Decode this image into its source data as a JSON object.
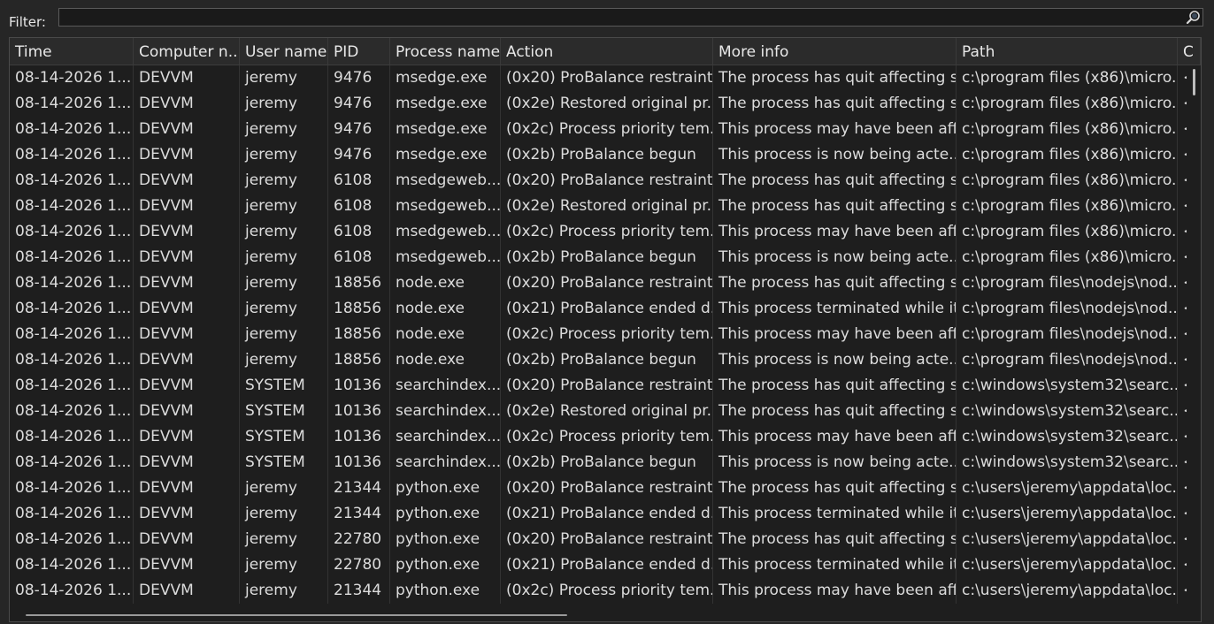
{
  "filter": {
    "label": "Filter:",
    "value": "",
    "placeholder": "",
    "search_icon": "search-icon"
  },
  "columns": [
    "Time",
    "Computer n...",
    "User name",
    "PID",
    "Process name",
    "Action",
    "More info",
    "Path",
    "C"
  ],
  "rows": [
    [
      "08-14-2026 1...",
      "DEVVM",
      "jeremy",
      "9476",
      "msedge.exe",
      "(0x20) ProBalance restraint ...",
      "The process has quit affecting s...",
      "c:\\program files (x86)\\micro...",
      "<"
    ],
    [
      "08-14-2026 1...",
      "DEVVM",
      "jeremy",
      "9476",
      "msedge.exe",
      "(0x2e) Restored original pr...",
      "The process has quit affecting s...",
      "c:\\program files (x86)\\micro...",
      "<"
    ],
    [
      "08-14-2026 1...",
      "DEVVM",
      "jeremy",
      "9476",
      "msedge.exe",
      "(0x2c) Process priority tem...",
      "This process may have been aff...",
      "c:\\program files (x86)\\micro...",
      "<"
    ],
    [
      "08-14-2026 1...",
      "DEVVM",
      "jeremy",
      "9476",
      "msedge.exe",
      "(0x2b) ProBalance begun",
      "This process is now being acte...",
      "c:\\program files (x86)\\micro...",
      "<"
    ],
    [
      "08-14-2026 1...",
      "DEVVM",
      "jeremy",
      "6108",
      "msedgeweb...",
      "(0x20) ProBalance restraint ...",
      "The process has quit affecting s...",
      "c:\\program files (x86)\\micro...",
      "<"
    ],
    [
      "08-14-2026 1...",
      "DEVVM",
      "jeremy",
      "6108",
      "msedgeweb...",
      "(0x2e) Restored original pr...",
      "The process has quit affecting s...",
      "c:\\program files (x86)\\micro...",
      "<"
    ],
    [
      "08-14-2026 1...",
      "DEVVM",
      "jeremy",
      "6108",
      "msedgeweb...",
      "(0x2c) Process priority tem...",
      "This process may have been aff...",
      "c:\\program files (x86)\\micro...",
      "<"
    ],
    [
      "08-14-2026 1...",
      "DEVVM",
      "jeremy",
      "6108",
      "msedgeweb...",
      "(0x2b) ProBalance begun",
      "This process is now being acte...",
      "c:\\program files (x86)\\micro...",
      "<"
    ],
    [
      "08-14-2026 1...",
      "DEVVM",
      "jeremy",
      "18856",
      "node.exe",
      "(0x20) ProBalance restraint ...",
      "The process has quit affecting s...",
      "c:\\program files\\nodejs\\nod...",
      "<"
    ],
    [
      "08-14-2026 1...",
      "DEVVM",
      "jeremy",
      "18856",
      "node.exe",
      "(0x21) ProBalance ended d...",
      "This process terminated while it...",
      "c:\\program files\\nodejs\\nod...",
      "<"
    ],
    [
      "08-14-2026 1...",
      "DEVVM",
      "jeremy",
      "18856",
      "node.exe",
      "(0x2c) Process priority tem...",
      "This process may have been aff...",
      "c:\\program files\\nodejs\\nod...",
      "<"
    ],
    [
      "08-14-2026 1...",
      "DEVVM",
      "jeremy",
      "18856",
      "node.exe",
      "(0x2b) ProBalance begun",
      "This process is now being acte...",
      "c:\\program files\\nodejs\\nod...",
      "<"
    ],
    [
      "08-14-2026 1...",
      "DEVVM",
      "SYSTEM",
      "10136",
      "searchindex...",
      "(0x20) ProBalance restraint ...",
      "The process has quit affecting s...",
      "c:\\windows\\system32\\searc...",
      "<"
    ],
    [
      "08-14-2026 1...",
      "DEVVM",
      "SYSTEM",
      "10136",
      "searchindex...",
      "(0x2e) Restored original pr...",
      "The process has quit affecting s...",
      "c:\\windows\\system32\\searc...",
      "<"
    ],
    [
      "08-14-2026 1...",
      "DEVVM",
      "SYSTEM",
      "10136",
      "searchindex...",
      "(0x2c) Process priority tem...",
      "This process may have been aff...",
      "c:\\windows\\system32\\searc...",
      "<"
    ],
    [
      "08-14-2026 1...",
      "DEVVM",
      "SYSTEM",
      "10136",
      "searchindex...",
      "(0x2b) ProBalance begun",
      "This process is now being acte...",
      "c:\\windows\\system32\\searc...",
      "<"
    ],
    [
      "08-14-2026 1...",
      "DEVVM",
      "jeremy",
      "21344",
      "python.exe",
      "(0x20) ProBalance restraint ...",
      "The process has quit affecting s...",
      "c:\\users\\jeremy\\appdata\\loc...",
      "<"
    ],
    [
      "08-14-2026 1...",
      "DEVVM",
      "jeremy",
      "21344",
      "python.exe",
      "(0x21) ProBalance ended d...",
      "This process terminated while it...",
      "c:\\users\\jeremy\\appdata\\loc...",
      "<"
    ],
    [
      "08-14-2026 1...",
      "DEVVM",
      "jeremy",
      "22780",
      "python.exe",
      "(0x20) ProBalance restraint ...",
      "The process has quit affecting s...",
      "c:\\users\\jeremy\\appdata\\loc...",
      "<"
    ],
    [
      "08-14-2026 1...",
      "DEVVM",
      "jeremy",
      "22780",
      "python.exe",
      "(0x21) ProBalance ended d...",
      "This process terminated while it...",
      "c:\\users\\jeremy\\appdata\\loc...",
      "<"
    ],
    [
      "08-14-2026 1...",
      "DEVVM",
      "jeremy",
      "21344",
      "python.exe",
      "(0x2c) Process priority tem...",
      "This process may have been aff...",
      "c:\\users\\jeremy\\appdata\\loc...",
      "<"
    ]
  ]
}
